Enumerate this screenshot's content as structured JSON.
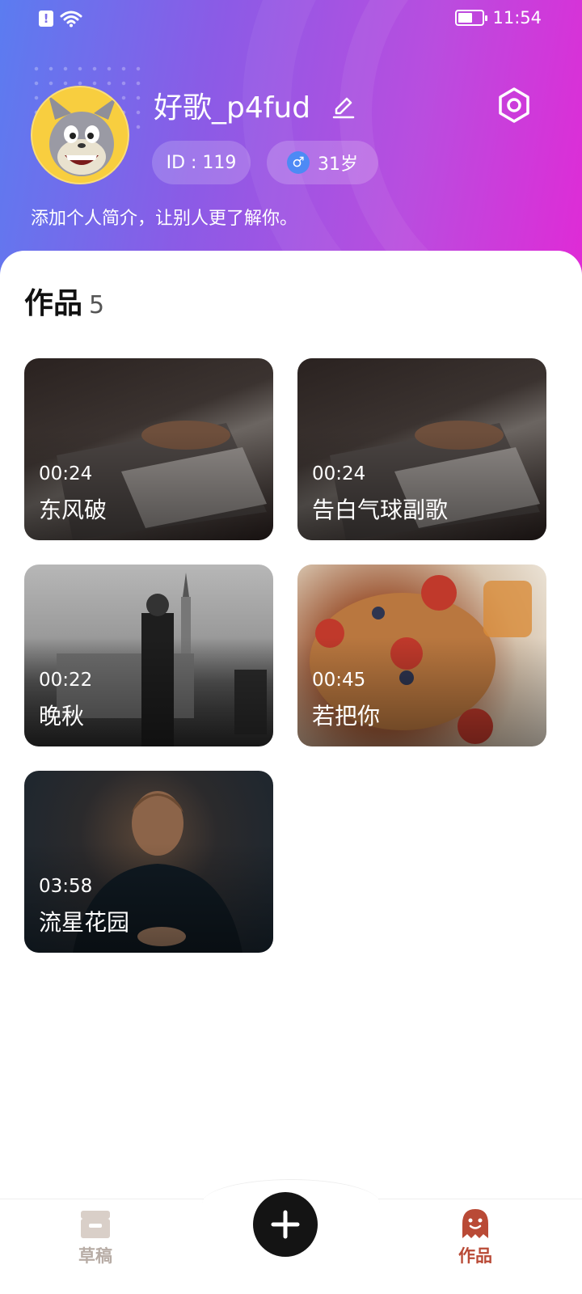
{
  "status_bar": {
    "time": "11:54",
    "battery_level": 0.6
  },
  "profile": {
    "username": "好歌_p4fud",
    "id_label": "ID : 119",
    "gender_symbol": "♂",
    "age_label": "31岁",
    "bio": "添加个人简介，让别人更了解你。"
  },
  "works": {
    "title": "作品",
    "count": "5",
    "items": [
      {
        "duration": "00:24",
        "title": "东风破"
      },
      {
        "duration": "00:24",
        "title": "告白气球副歌"
      },
      {
        "duration": "00:22",
        "title": "晚秋"
      },
      {
        "duration": "00:45",
        "title": "若把你"
      },
      {
        "duration": "03:58",
        "title": "流星花园"
      }
    ]
  },
  "tabbar": {
    "drafts_label": "草稿",
    "works_label": "作品",
    "active_color": "#b94a36",
    "inactive_color": "#b7aca5"
  },
  "icons": [
    "alert-icon",
    "wifi-icon",
    "battery-icon",
    "edit-icon",
    "settings-icon",
    "drafts-icon",
    "works-icon",
    "plus-icon"
  ]
}
